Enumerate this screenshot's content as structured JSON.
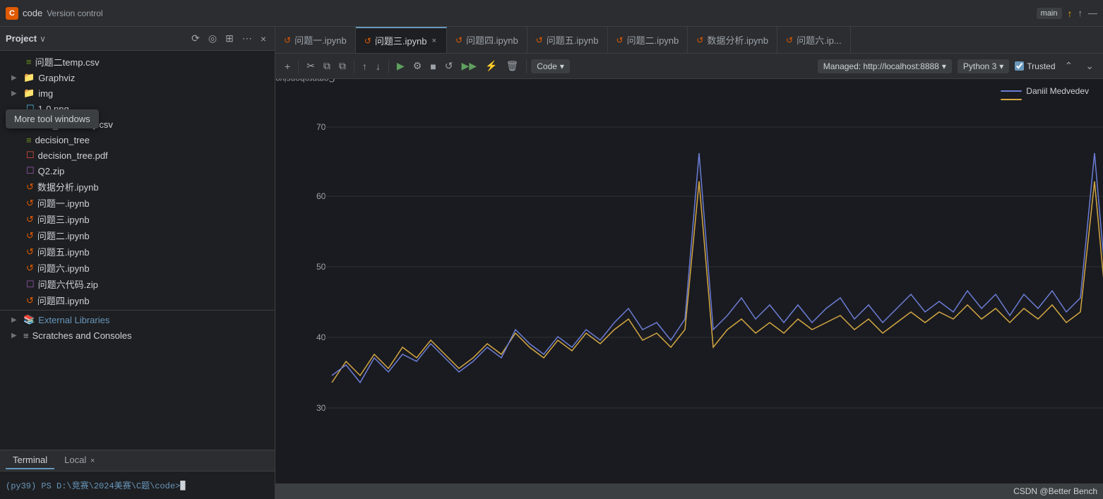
{
  "topbar": {
    "logo": "C",
    "title": "code",
    "subtitle": "Version control",
    "branch": "main",
    "update_icon": "↑"
  },
  "sidebar": {
    "title": "Project",
    "caret": "∨",
    "tooltip": "More tool windows",
    "files": [
      {
        "type": "csv",
        "icon": "≡",
        "name": "问题二temp.csv",
        "indent": 1
      },
      {
        "type": "dir",
        "icon": "▶",
        "name": "Graphviz",
        "indent": 0
      },
      {
        "type": "dir",
        "icon": "▶",
        "name": "img",
        "indent": 0
      },
      {
        "type": "img",
        "icon": "☐",
        "name": "1-0.png",
        "indent": 1
      },
      {
        "type": "csv",
        "icon": "≡",
        "name": "data_dictionary.csv",
        "indent": 1
      },
      {
        "type": "tree",
        "icon": "≡",
        "name": "decision_tree",
        "indent": 1
      },
      {
        "type": "pdf",
        "icon": "☐",
        "name": "decision_tree.pdf",
        "indent": 1
      },
      {
        "type": "zip",
        "icon": "☐",
        "name": "Q2.zip",
        "indent": 1
      },
      {
        "type": "nb",
        "icon": "↺",
        "name": "数据分析.ipynb",
        "indent": 1
      },
      {
        "type": "nb",
        "icon": "↺",
        "name": "问题一.ipynb",
        "indent": 1
      },
      {
        "type": "nb",
        "icon": "↺",
        "name": "问题三.ipynb",
        "indent": 1
      },
      {
        "type": "nb",
        "icon": "↺",
        "name": "问题二.ipynb",
        "indent": 1
      },
      {
        "type": "nb",
        "icon": "↺",
        "name": "问题五.ipynb",
        "indent": 1
      },
      {
        "type": "nb",
        "icon": "↺",
        "name": "问题六.ipynb",
        "indent": 1
      },
      {
        "type": "zip",
        "icon": "☐",
        "name": "问题六代码.zip",
        "indent": 1
      },
      {
        "type": "nb",
        "icon": "↺",
        "name": "问题四.ipynb",
        "indent": 1
      }
    ],
    "external_libraries": "External Libraries",
    "scratches": "Scratches and Consoles"
  },
  "notebook_tabs": [
    {
      "icon": "↺",
      "name": "问题一.ipynb",
      "active": false,
      "closeable": false
    },
    {
      "icon": "↺",
      "name": "问题三.ipynb",
      "active": true,
      "closeable": true
    },
    {
      "icon": "↺",
      "name": "问题四.ipynb",
      "active": false,
      "closeable": false
    },
    {
      "icon": "↺",
      "name": "问题五.ipynb",
      "active": false,
      "closeable": false
    },
    {
      "icon": "↺",
      "name": "问题二.ipynb",
      "active": false,
      "closeable": false
    },
    {
      "icon": "↺",
      "name": "数据分析.ipynb",
      "active": false,
      "closeable": false
    },
    {
      "icon": "↺",
      "name": "问题六.ip...",
      "active": false,
      "closeable": false
    }
  ],
  "toolbar": {
    "add_label": "+",
    "cut_label": "✂",
    "copy_label": "⧉",
    "paste_label": "⧉",
    "move_up_label": "↑",
    "move_down_label": "↓",
    "run_label": "▶",
    "run_config_label": "⚙",
    "stop_label": "■",
    "restart_label": "↺",
    "run_all_label": "▶▶",
    "clear_label": "⚡",
    "delete_label": "🗑",
    "cell_type": "Code",
    "server": "Managed: http://localhost:8888",
    "kernel": "Python 3",
    "trusted": "Trusted"
  },
  "chart": {
    "y_label": "Comprehensive Score",
    "y_ticks": [
      "70",
      "60",
      "50",
      "40",
      "30"
    ],
    "legend": [
      {
        "label": "Daniil Medvedev",
        "color": "#6B7DD6"
      },
      {
        "label": "",
        "color": "#D4A843"
      }
    ]
  },
  "bottom": {
    "tabs": [
      {
        "label": "Terminal",
        "active": true
      },
      {
        "label": "Local",
        "active": false,
        "closeable": true
      }
    ],
    "prompt": "(py39) PS D:\\竞赛\\2024美赛\\C题\\code> ",
    "cursor": "█"
  },
  "statusbar": {
    "right_text": "CSDN @Better Bench"
  }
}
